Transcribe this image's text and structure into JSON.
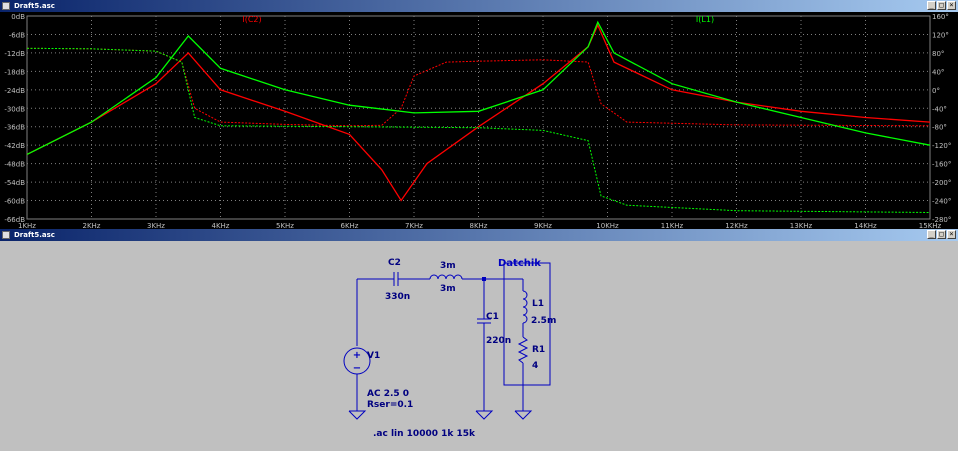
{
  "plot_window": {
    "title": "Draft5.asc",
    "minimize": "_",
    "restore": "□",
    "close": "×"
  },
  "schematic_window": {
    "title": "Draft5.asc",
    "minimize": "_",
    "restore": "□",
    "close": "×"
  },
  "colors": {
    "plot_background": "#000000",
    "grid": "#808080",
    "axis_text": "#c0c0c0",
    "trace_ic2": "#ff0000",
    "trace_il1": "#00ff00",
    "schematic_wire": "#0000c0",
    "schematic_text": "#000080",
    "schematic_bg": "#c0c0c0"
  },
  "chart_data": {
    "type": "line",
    "x_scale": "linear",
    "xlim": [
      1000,
      15000
    ],
    "x_ticks": [
      "1KHz",
      "2KHz",
      "3KHz",
      "4KHz",
      "5KHz",
      "6KHz",
      "7KHz",
      "8KHz",
      "9KHz",
      "10KHz",
      "11KHz",
      "12KHz",
      "13KHz",
      "14KHz",
      "15KHz"
    ],
    "ylim_left": [
      -66,
      0
    ],
    "y_ticks_left": [
      "0dB",
      "-6dB",
      "-12dB",
      "-18dB",
      "-24dB",
      "-30dB",
      "-36dB",
      "-42dB",
      "-48dB",
      "-54dB",
      "-60dB",
      "-66dB"
    ],
    "ylim_right": [
      -280,
      160
    ],
    "y_ticks_right": [
      "160°",
      "120°",
      "80°",
      "40°",
      "0°",
      "-40°",
      "-80°",
      "-120°",
      "-160°",
      "-200°",
      "-240°",
      "-280°"
    ],
    "grid": "dotted",
    "series": [
      {
        "name": "I(C2)",
        "color": "#ff0000",
        "magnitude_db": [
          [
            1000,
            -45
          ],
          [
            2000,
            -34.5
          ],
          [
            3000,
            -22
          ],
          [
            3500,
            -12
          ],
          [
            4000,
            -24
          ],
          [
            5000,
            -31
          ],
          [
            6000,
            -38.5
          ],
          [
            6500,
            -50
          ],
          [
            6800,
            -60
          ],
          [
            7200,
            -48
          ],
          [
            8000,
            -36
          ],
          [
            9000,
            -22
          ],
          [
            9700,
            -10
          ],
          [
            9850,
            -3
          ],
          [
            10100,
            -15
          ],
          [
            11000,
            -24
          ],
          [
            12000,
            -28
          ],
          [
            13000,
            -31
          ],
          [
            14000,
            -33
          ],
          [
            15000,
            -34.5
          ]
        ],
        "phase_deg": [
          [
            1000,
            90
          ],
          [
            2000,
            89
          ],
          [
            3000,
            84
          ],
          [
            3400,
            60
          ],
          [
            3600,
            -40
          ],
          [
            4000,
            -70
          ],
          [
            5000,
            -75
          ],
          [
            6000,
            -78
          ],
          [
            6500,
            -77
          ],
          [
            6800,
            -40
          ],
          [
            7000,
            30
          ],
          [
            7500,
            60
          ],
          [
            8000,
            62
          ],
          [
            9000,
            65
          ],
          [
            9700,
            60
          ],
          [
            9900,
            -30
          ],
          [
            10300,
            -70
          ],
          [
            12000,
            -76
          ],
          [
            15000,
            -78
          ]
        ]
      },
      {
        "name": "I(L1)",
        "color": "#00ff00",
        "magnitude_db": [
          [
            1000,
            -45
          ],
          [
            2000,
            -34.5
          ],
          [
            3000,
            -20
          ],
          [
            3500,
            -6.5
          ],
          [
            4000,
            -17
          ],
          [
            5000,
            -24
          ],
          [
            6000,
            -29
          ],
          [
            7000,
            -31.5
          ],
          [
            8000,
            -31
          ],
          [
            9000,
            -24
          ],
          [
            9700,
            -10
          ],
          [
            9850,
            -2
          ],
          [
            10100,
            -12
          ],
          [
            11000,
            -22
          ],
          [
            12000,
            -28
          ],
          [
            13000,
            -33
          ],
          [
            14000,
            -38
          ],
          [
            15000,
            -42
          ]
        ],
        "phase_deg": [
          [
            1000,
            90
          ],
          [
            2000,
            89
          ],
          [
            3000,
            84
          ],
          [
            3400,
            60
          ],
          [
            3600,
            -60
          ],
          [
            4000,
            -78
          ],
          [
            6000,
            -80
          ],
          [
            8000,
            -82
          ],
          [
            9000,
            -88
          ],
          [
            9700,
            -110
          ],
          [
            9900,
            -230
          ],
          [
            10300,
            -250
          ],
          [
            12000,
            -262
          ],
          [
            15000,
            -266
          ]
        ]
      }
    ]
  },
  "schematic": {
    "block_label": "Datchik",
    "components": {
      "c2_name": "C2",
      "c2_value": "330n",
      "l_top_a": "3m",
      "l_top_b": "3m",
      "c1_name": "C1",
      "c1_value": "220n",
      "l1_name": "L1",
      "l1_value": "2.5m",
      "r1_name": "R1",
      "r1_value": "4",
      "v1_name": "V1",
      "v1_value": "AC 2.5 0",
      "v1_rser": "Rser=0.1"
    },
    "directive": ".ac lin 10000 1k 15k"
  }
}
